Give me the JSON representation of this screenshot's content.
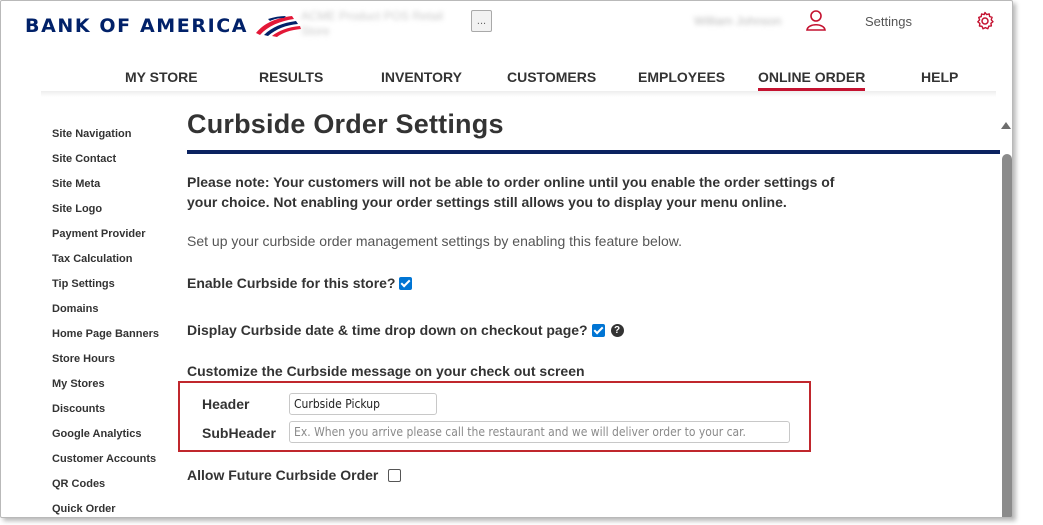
{
  "header": {
    "brand": "BANK OF AMERICA",
    "store_name": "ACME Product POS Retail Store",
    "ellipsis_label": "...",
    "user_name": "William Johnson",
    "settings_label": "Settings"
  },
  "nav": {
    "items": [
      {
        "label": "MY STORE"
      },
      {
        "label": "RESULTS"
      },
      {
        "label": "INVENTORY"
      },
      {
        "label": "CUSTOMERS"
      },
      {
        "label": "EMPLOYEES"
      },
      {
        "label": "ONLINE ORDER",
        "active": true
      },
      {
        "label": "HELP"
      }
    ]
  },
  "sidebar": {
    "items": [
      "Site Navigation",
      "Site Contact",
      "Site Meta",
      "Site Logo",
      "Payment Provider",
      "Tax Calculation",
      "Tip Settings",
      "Domains",
      "Home Page Banners",
      "Store Hours",
      "My Stores",
      "Discounts",
      "Google Analytics",
      "Customer Accounts",
      "QR Codes",
      "Quick Order"
    ]
  },
  "main": {
    "title": "Curbside Order Settings",
    "note": "Please note: Your customers will not be able to order online until you enable the order settings of your choice. Not enabling your order settings still allows you to display your menu online.",
    "intro": "Set up your curbside order management settings by enabling this feature below.",
    "enable_label": "Enable Curbside for this store?",
    "enable_checked": true,
    "display_label": "Display Curbside date & time drop down on checkout page?",
    "display_checked": true,
    "help_glyph": "?",
    "customize_label": "Customize the Curbside message on your check out screen",
    "header_label": "Header",
    "header_value": "Curbside Pickup",
    "subheader_label": "SubHeader",
    "subheader_placeholder": "Ex. When you arrive please call the restaurant and we will deliver order to your car.",
    "future_label": "Allow Future Curbside Order",
    "future_checked": false
  },
  "colors": {
    "brand_navy": "#012169",
    "accent_red": "#c41230",
    "title_rule": "#0b2260",
    "checkbox_blue": "#0075d4"
  },
  "icons": [
    "flag-logo-icon",
    "user-icon",
    "gear-icon",
    "help-icon",
    "scroll-up-icon"
  ]
}
